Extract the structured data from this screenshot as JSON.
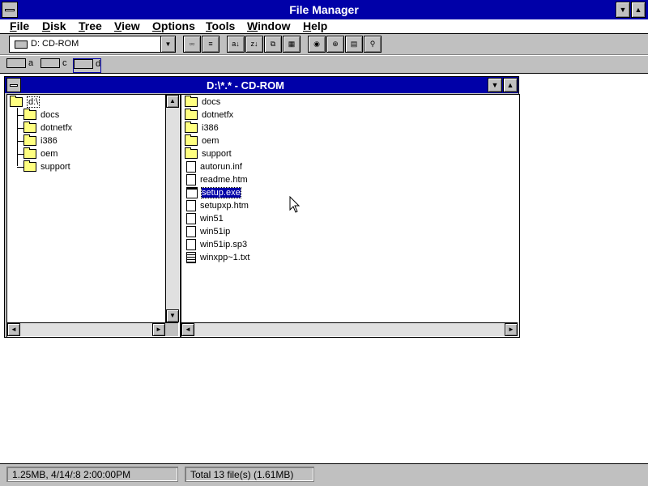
{
  "window": {
    "title": "File Manager"
  },
  "menu": [
    "File",
    "Disk",
    "Tree",
    "View",
    "Options",
    "Tools",
    "Window",
    "Help"
  ],
  "toolbar": {
    "drive_label": "D: CD-ROM"
  },
  "drives": [
    "a",
    "c",
    "d"
  ],
  "child": {
    "title": "D:\\*.* - CD-ROM"
  },
  "tree": {
    "root": "d:\\",
    "items": [
      "docs",
      "dotnetfx",
      "i386",
      "oem",
      "support"
    ]
  },
  "files": [
    {
      "name": "docs",
      "type": "folder"
    },
    {
      "name": "dotnetfx",
      "type": "folder"
    },
    {
      "name": "i386",
      "type": "folder"
    },
    {
      "name": "oem",
      "type": "folder"
    },
    {
      "name": "support",
      "type": "folder"
    },
    {
      "name": "autorun.inf",
      "type": "file"
    },
    {
      "name": "readme.htm",
      "type": "file"
    },
    {
      "name": "setup.exe",
      "type": "program",
      "selected": true
    },
    {
      "name": "setupxp.htm",
      "type": "file"
    },
    {
      "name": "win51",
      "type": "file"
    },
    {
      "name": "win51ip",
      "type": "file"
    },
    {
      "name": "win51ip.sp3",
      "type": "file"
    },
    {
      "name": "winxpp~1.txt",
      "type": "text"
    }
  ],
  "status": {
    "left": "1.25MB, 4/14/:8 2:00:00PM",
    "right": "Total 13 file(s) (1.61MB)"
  }
}
